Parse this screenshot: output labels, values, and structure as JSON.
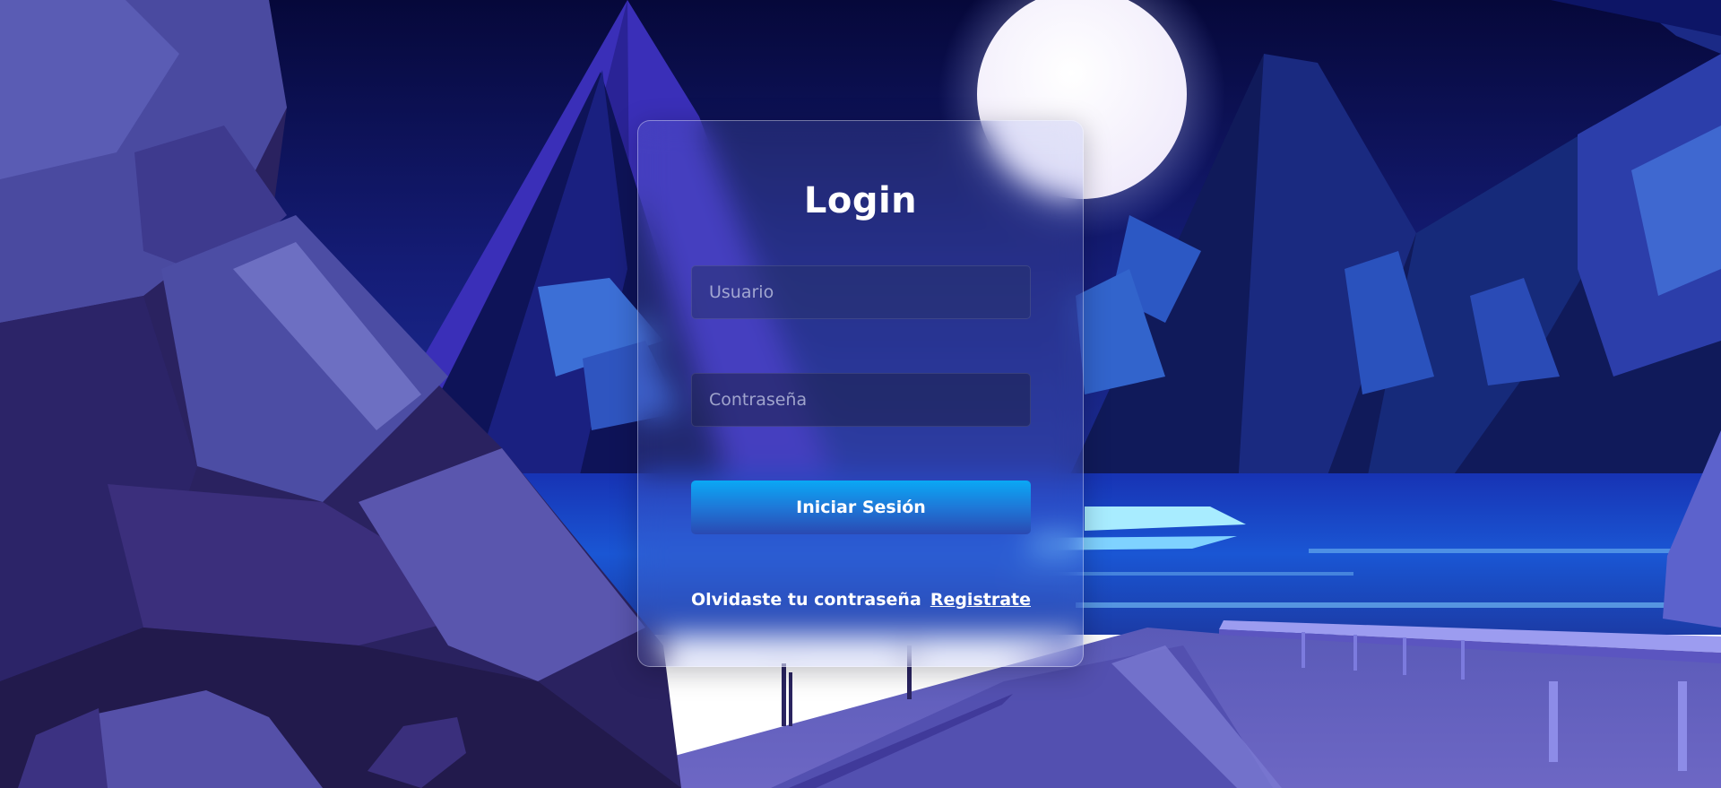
{
  "login": {
    "title": "Login",
    "username_placeholder": "Usuario",
    "password_placeholder": "Contraseña",
    "submit_label": "Iniciar Sesión",
    "forgot_password_label": "Olvidaste tu contraseña",
    "register_label": "Registrate"
  },
  "theme": {
    "button_gradient_top": "#0aa8f5",
    "button_gradient_bottom": "#2a49b2",
    "text_color": "#ffffff",
    "card_border": "rgba(255,255,255,0.38)"
  }
}
